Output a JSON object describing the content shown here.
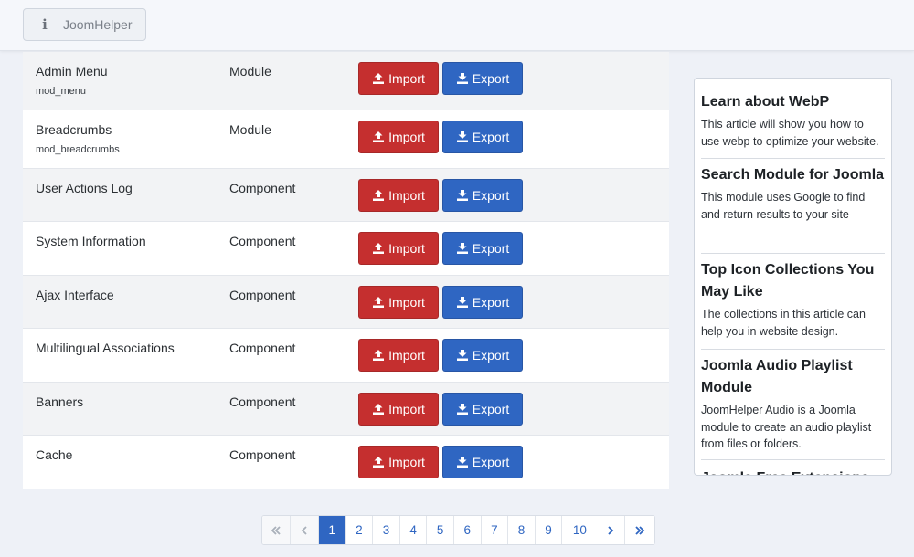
{
  "toolbar": {
    "joomhelper_label": "JoomHelper",
    "info_glyph": "i"
  },
  "table": {
    "import_label": "Import",
    "export_label": "Export",
    "rows": [
      {
        "name": "Admin Menu",
        "element": "mod_menu",
        "type": "Module"
      },
      {
        "name": "Breadcrumbs",
        "element": "mod_breadcrumbs",
        "type": "Module"
      },
      {
        "name": "User Actions Log",
        "element": "",
        "type": "Component"
      },
      {
        "name": "System Information",
        "element": "",
        "type": "Component"
      },
      {
        "name": "Ajax Interface",
        "element": "",
        "type": "Component"
      },
      {
        "name": "Multilingual Associations",
        "element": "",
        "type": "Component"
      },
      {
        "name": "Banners",
        "element": "",
        "type": "Component"
      },
      {
        "name": "Cache",
        "element": "",
        "type": "Component"
      }
    ]
  },
  "sidebar": {
    "articles": [
      {
        "title": "Learn about WebP",
        "desc": "This article will show you how to use webp to optimize your website."
      },
      {
        "title": "Search Module for Joomla",
        "desc": "This module uses Google to find and return results to your site"
      },
      {
        "title": "Top Icon Collections You May Like",
        "desc": "The collections in this article can help you in website design."
      },
      {
        "title": "Joomla Audio Playlist Module",
        "desc": "JoomHelper Audio is a Joomla module to create an audio playlist from files or folders."
      },
      {
        "title": "Joomla Free Extensions",
        "desc": ""
      }
    ]
  },
  "pagination": {
    "pages": [
      "1",
      "2",
      "3",
      "4",
      "5",
      "6",
      "7",
      "8",
      "9",
      "10"
    ],
    "active_page": "1"
  },
  "colors": {
    "import": "#c52f2f",
    "export": "#2f66c2",
    "page_active": "#2f66c2"
  },
  "icons": {
    "toolbar": "info-icon",
    "import": "upload-icon",
    "export": "download-icon",
    "first": "double-chevron-left-icon",
    "prev": "chevron-left-icon",
    "next": "chevron-right-icon",
    "last": "double-chevron-right-icon"
  }
}
